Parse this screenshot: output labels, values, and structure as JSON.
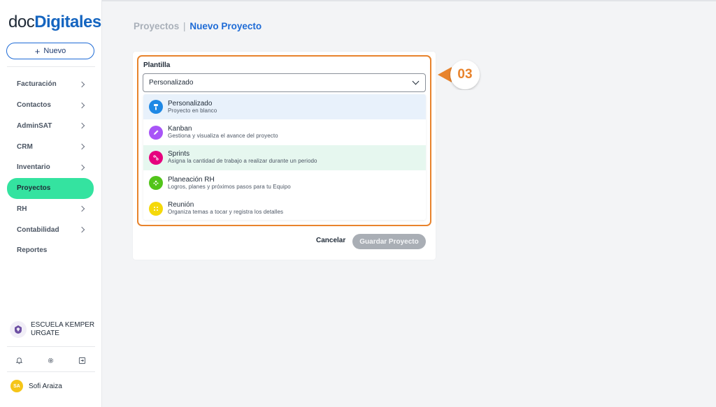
{
  "brand": {
    "logo_part1": "doc",
    "logo_part2": "Digitales"
  },
  "sidebar": {
    "new_button": {
      "icon": "+",
      "label": "Nuevo"
    },
    "items": [
      {
        "label": "Facturación",
        "has_chevron": true,
        "active": false
      },
      {
        "label": "Contactos",
        "has_chevron": true,
        "active": false
      },
      {
        "label": "AdminSAT",
        "has_chevron": true,
        "active": false
      },
      {
        "label": "CRM",
        "has_chevron": true,
        "active": false
      },
      {
        "label": "Inventario",
        "has_chevron": true,
        "active": false
      },
      {
        "label": "Proyectos",
        "has_chevron": false,
        "active": true
      },
      {
        "label": "RH",
        "has_chevron": true,
        "active": false
      },
      {
        "label": "Contabilidad",
        "has_chevron": true,
        "active": false
      },
      {
        "label": "Reportes",
        "has_chevron": false,
        "active": false
      }
    ],
    "organization": {
      "name": "ESCUELA KEMPER URGATE"
    },
    "tools": [
      "bell-icon",
      "gear-icon",
      "logout-icon"
    ],
    "user": {
      "initials": "SA",
      "name": "Sofi Araiza"
    }
  },
  "breadcrumb": {
    "parent": "Proyectos",
    "separator": "|",
    "current": "Nuevo Proyecto"
  },
  "form": {
    "template_label": "Plantilla",
    "template_value": "Personalizado",
    "options": [
      {
        "title": "Personalizado",
        "description": "Proyecto en blanco",
        "icon": "paint-roller-icon",
        "color": "#1e88e5",
        "state": "selected"
      },
      {
        "title": "Kanban",
        "description": "Gestiona y visualiza el avance del proyecto",
        "icon": "pencil-icon",
        "color": "#a855f7",
        "state": "normal"
      },
      {
        "title": "Sprints",
        "description": "Asigna la cantidad de trabajo a realizar durante un periodo",
        "icon": "route-icon",
        "color": "#e6007e",
        "state": "hover"
      },
      {
        "title": "Planeación RH",
        "description": "Logros, planes y próximos pasos para tu Equipo",
        "icon": "team-icon",
        "color": "#52c41a",
        "state": "normal"
      },
      {
        "title": "Reunión",
        "description": "Organiza temas a tocar y registra los detalles",
        "icon": "meeting-icon",
        "color": "#f5d90a",
        "state": "normal"
      }
    ],
    "cancel_label": "Cancelar",
    "save_label": "Guardar Proyecto"
  },
  "annotation": {
    "step": "03",
    "color": "#e8832c"
  }
}
